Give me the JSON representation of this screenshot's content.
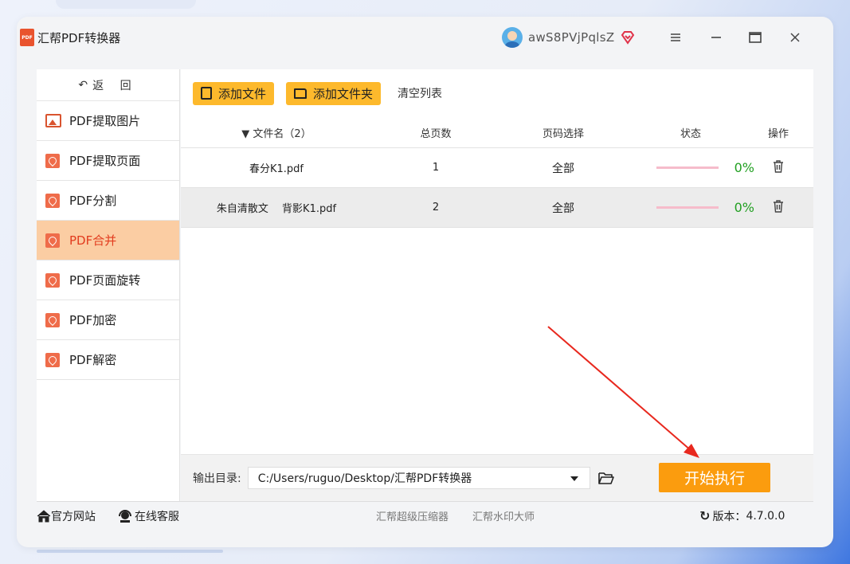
{
  "app": {
    "title": "汇帮PDF转换器",
    "logo_text": "PDF",
    "username": "awS8PVjPqlsZ",
    "accent_color": "#fdb92c",
    "active_color": "#fbcda3"
  },
  "sidebar": {
    "back_label": "返 回",
    "items": [
      {
        "label": "PDF提取图片",
        "icon": "image-icon"
      },
      {
        "label": "PDF提取页面",
        "icon": "pdf-icon"
      },
      {
        "label": "PDF分割",
        "icon": "pdf-icon"
      },
      {
        "label": "PDF合并",
        "icon": "pdf-icon",
        "active": true
      },
      {
        "label": "PDF页面旋转",
        "icon": "pdf-icon"
      },
      {
        "label": "PDF加密",
        "icon": "pdf-icon"
      },
      {
        "label": "PDF解密",
        "icon": "pdf-icon"
      }
    ]
  },
  "toolbar": {
    "add_file": "添加文件",
    "add_folder": "添加文件夹",
    "clear_list": "清空列表"
  },
  "table": {
    "headers": {
      "name": "文件名（2）",
      "pages": "总页数",
      "range": "页码选择",
      "status": "状态",
      "op": "操作"
    },
    "rows": [
      {
        "name": "春分K1.pdf",
        "pages": "1",
        "range": "全部",
        "progress": "0%"
      },
      {
        "name": "朱自清散文　 背影K1.pdf",
        "pages": "2",
        "range": "全部",
        "progress": "0%"
      }
    ]
  },
  "output": {
    "label": "输出目录:",
    "path": "C:/Users/ruguo/Desktop/汇帮PDF转换器",
    "start_label": "开始执行"
  },
  "footer": {
    "website": "官方网站",
    "support": "在线客服",
    "compressor": "汇帮超级压缩器",
    "watermark": "汇帮水印大师",
    "version_label": "版本：",
    "version": "4.7.0.0"
  }
}
